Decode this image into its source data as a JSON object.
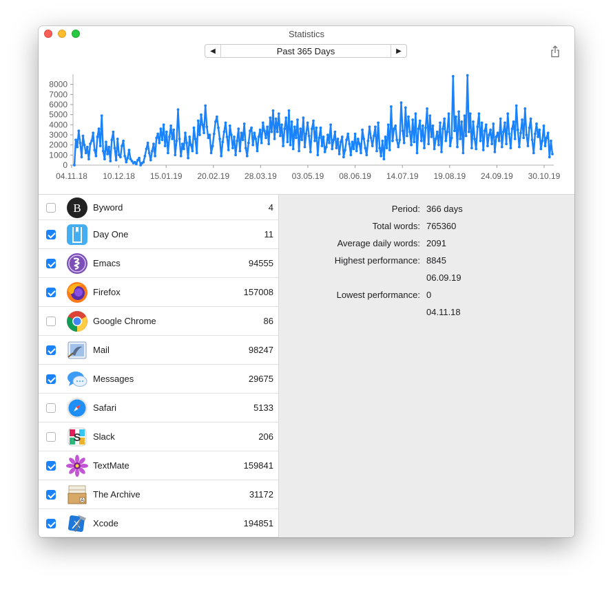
{
  "window": {
    "title": "Statistics"
  },
  "period_selector": {
    "prev_label": "◀",
    "label": "Past 365 Days",
    "next_label": "▶"
  },
  "chart_data": {
    "type": "line",
    "title": "",
    "xlabel": "",
    "ylabel": "",
    "ylim": [
      0,
      9000
    ],
    "y_ticks": [
      0,
      1000,
      2000,
      3000,
      4000,
      5000,
      6000,
      7000,
      8000
    ],
    "x_tick_labels": [
      "04.11.18",
      "10.12.18",
      "15.01.19",
      "20.02.19",
      "28.03.19",
      "03.05.19",
      "08.06.19",
      "14.07.19",
      "19.08.19",
      "24.09.19",
      "30.10.19"
    ],
    "series_color": "#1a82fb",
    "series": [
      {
        "values": [
          0,
          2500,
          1800,
          3400,
          2200,
          800,
          2900,
          2000,
          1200,
          1800,
          600,
          2100,
          2400,
          3200,
          1500,
          900,
          2800,
          3600,
          1900,
          4900,
          1400,
          600,
          2300,
          1100,
          1800,
          400,
          2500,
          3300,
          1700,
          500,
          2600,
          1000,
          800,
          1900,
          2400,
          900,
          300,
          700,
          1500,
          600,
          400,
          200,
          300,
          100,
          500,
          700,
          0,
          200,
          300,
          900,
          1600,
          2200,
          1200,
          500,
          1400,
          2100,
          900,
          2700,
          3100,
          2200,
          3600,
          2500,
          4000,
          1900,
          3300,
          1200,
          2800,
          3900,
          2600,
          3500,
          1000,
          2400,
          5500,
          2600,
          900,
          2100,
          1600,
          3200,
          2200,
          700,
          2800,
          2000,
          1400,
          3700,
          2600,
          1200,
          4400,
          3000,
          5000,
          4000,
          3200,
          5900,
          3800,
          2700,
          3000,
          1200,
          1900,
          3100,
          4300,
          4800,
          3700,
          2600,
          900,
          2300,
          3300,
          4200,
          2800,
          1500,
          3900,
          3000,
          1700,
          2800,
          1000,
          2400,
          3600,
          1400,
          3200,
          2500,
          4100,
          1700,
          900,
          2200,
          3400,
          3700,
          2000,
          3200,
          2600,
          1400,
          2800,
          3500,
          2200,
          4200,
          3400,
          2700,
          3800,
          2100,
          4700,
          3300,
          5400,
          2600,
          4600,
          3300,
          5100,
          2900,
          4000,
          1900,
          3600,
          4700,
          2300,
          5400,
          2000,
          4300,
          1600,
          3800,
          2700,
          4500,
          1400,
          3600,
          2500,
          4700,
          1800,
          3100,
          4200,
          2900,
          1300,
          3600,
          4400,
          2400,
          3700,
          1000,
          2700,
          3700,
          1900,
          2800,
          1300,
          1800,
          3000,
          2200,
          4000,
          1600,
          2500,
          3300,
          1700,
          2600,
          1100,
          2300,
          2800,
          800,
          1500,
          2500,
          3100,
          2100,
          1000,
          2300,
          1600,
          3100,
          1400,
          2600,
          2100,
          1200,
          3500,
          2600,
          1700,
          1000,
          2400,
          3800,
          2700,
          1900,
          2900,
          3800,
          1400,
          4200,
          1700,
          900,
          2400,
          600,
          2800,
          1700,
          4000,
          1500,
          5800,
          2400,
          3600,
          3900,
          2500,
          1800,
          2500,
          6200,
          3400,
          2200,
          5700,
          2900,
          4800,
          3300,
          2000,
          4500,
          2300,
          5100,
          1200,
          3600,
          4400,
          2400,
          3900,
          1700,
          3700,
          5600,
          2100,
          4900,
          2800,
          3900,
          1600,
          2600,
          3300,
          2000,
          4200,
          1300,
          3600,
          4600,
          2400,
          3300,
          5100,
          1900,
          2700,
          8800,
          3400,
          4800,
          1800,
          5300,
          2600,
          4300,
          1200,
          4900,
          2900,
          8900,
          3300,
          5100,
          1700,
          4300,
          2600,
          1600,
          3800,
          5100,
          2400,
          4200,
          1500,
          3400,
          4000,
          1900,
          3000,
          3500,
          2100,
          4100,
          1300,
          2800,
          3200,
          2400,
          4600,
          1800,
          3300,
          4200,
          2100,
          5100,
          3100,
          1700,
          3600,
          4300,
          2600,
          5900,
          3500,
          1800,
          3200,
          4500,
          2700,
          5600,
          3000,
          1900,
          3700,
          4600,
          2500,
          1200,
          3100,
          4100,
          2800,
          3500,
          1600,
          2400,
          3900,
          1900,
          2700,
          3200,
          800,
          2400,
          1100
        ]
      }
    ]
  },
  "apps": [
    {
      "name": "Byword",
      "count": "4",
      "checked": false,
      "icon": "byword-icon"
    },
    {
      "name": "Day One",
      "count": "11",
      "checked": true,
      "icon": "day-one-icon"
    },
    {
      "name": "Emacs",
      "count": "94555",
      "checked": true,
      "icon": "emacs-icon"
    },
    {
      "name": "Firefox",
      "count": "157008",
      "checked": true,
      "icon": "firefox-icon"
    },
    {
      "name": "Google Chrome",
      "count": "86",
      "checked": false,
      "icon": "chrome-icon"
    },
    {
      "name": "Mail",
      "count": "98247",
      "checked": true,
      "icon": "mail-icon"
    },
    {
      "name": "Messages",
      "count": "29675",
      "checked": true,
      "icon": "messages-icon"
    },
    {
      "name": "Safari",
      "count": "5133",
      "checked": false,
      "icon": "safari-icon"
    },
    {
      "name": "Slack",
      "count": "206",
      "checked": false,
      "icon": "slack-icon"
    },
    {
      "name": "TextMate",
      "count": "159841",
      "checked": true,
      "icon": "textmate-icon"
    },
    {
      "name": "The Archive",
      "count": "31172",
      "checked": true,
      "icon": "the-archive-icon"
    },
    {
      "name": "Xcode",
      "count": "194851",
      "checked": true,
      "icon": "xcode-icon"
    }
  ],
  "stats": {
    "period_label": "Period:",
    "period_value": "366 days",
    "total_label": "Total words:",
    "total_value": "765360",
    "avg_label": "Average daily words:",
    "avg_value": "2091",
    "high_label": "Highest performance:",
    "high_value": "8845",
    "high_date": "06.09.19",
    "low_label": "Lowest performance:",
    "low_value": "0",
    "low_date": "04.11.18"
  }
}
